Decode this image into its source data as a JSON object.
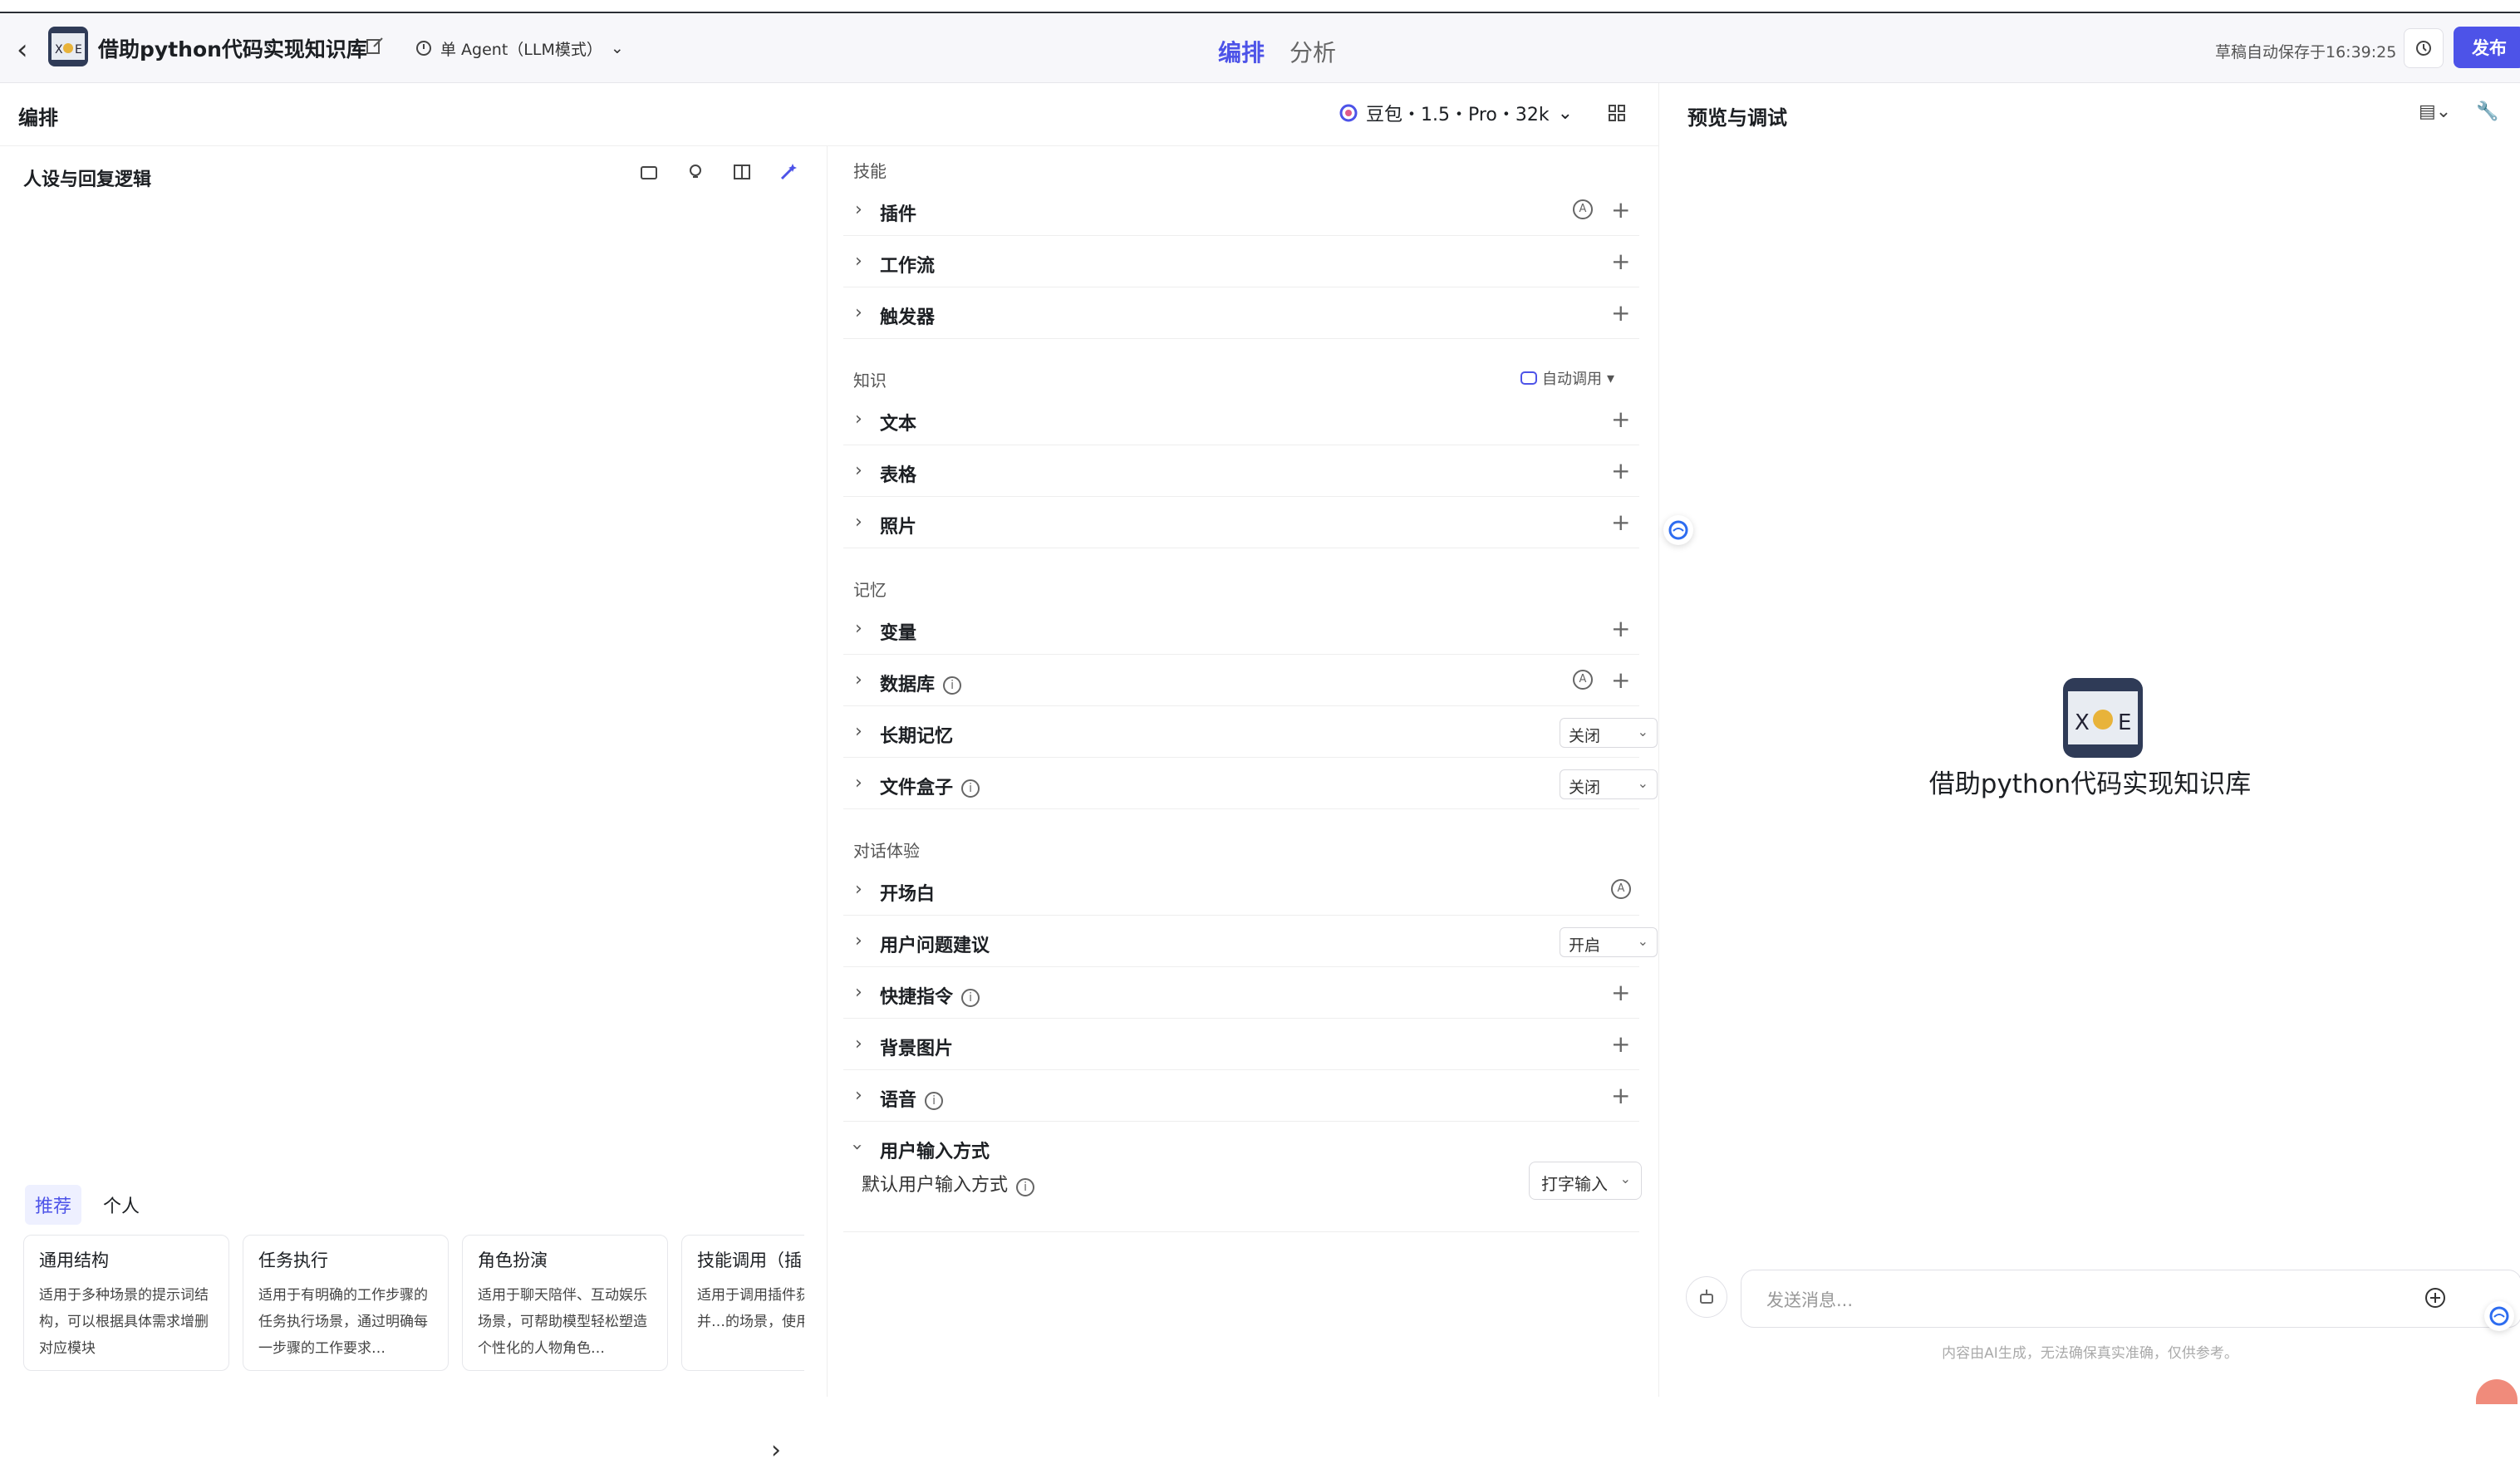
{
  "header": {
    "app_title": "借助python代码实现知识库",
    "mode": "单 Agent（LLM模式）",
    "tabs": [
      {
        "label": "编排"
      },
      {
        "label": "分析"
      }
    ],
    "autosave": "草稿自动保存于16:39:25",
    "publish": "发布"
  },
  "subheader": {
    "title": "编排",
    "model": "豆包・1.5・Pro・32k"
  },
  "persona": {
    "title": "人设与回复逻辑"
  },
  "templates": {
    "tabs": [
      "推荐",
      "个人"
    ],
    "cards": [
      {
        "title": "通用结构",
        "desc": "适用于多种场景的提示词结构，可以根据具体需求增删对应模块"
      },
      {
        "title": "任务执行",
        "desc": "适用于有明确的工作步骤的任务执行场景，通过明确每一步骤的工作要求…"
      },
      {
        "title": "角色扮演",
        "desc": "适用于聊天陪伴、互动娱乐场景，可帮助模型轻松塑造个性化的人物角色…"
      },
      {
        "title": "技能调用（插",
        "desc": "适用于调用插件获取信息并…的场景，使用…"
      }
    ]
  },
  "config": {
    "skills_title": "技能",
    "skills": [
      "插件",
      "工作流",
      "触发器"
    ],
    "knowledge_title": "知识",
    "auto_call": "自动调用",
    "knowledge": [
      "文本",
      "表格",
      "照片"
    ],
    "memory_title": "记忆",
    "memory": [
      "变量",
      "数据库",
      "长期记忆",
      "文件盒子"
    ],
    "long_memory_value": "关闭",
    "file_box_value": "关闭",
    "chat_title": "对话体验",
    "chat": [
      "开场白",
      "用户问题建议",
      "快捷指令",
      "背景图片",
      "语音",
      "用户输入方式"
    ],
    "suggest_value": "开启",
    "input_mode_label": "默认用户输入方式",
    "input_mode_value": "打字输入"
  },
  "preview": {
    "title": "预览与调试",
    "bot_name": "借助python代码实现知识库",
    "input_placeholder": "发送消息...",
    "disclaimer": "内容由AI生成，无法确保真实准确，仅供参考。"
  },
  "colors": {
    "accent": "#4d53e8"
  }
}
